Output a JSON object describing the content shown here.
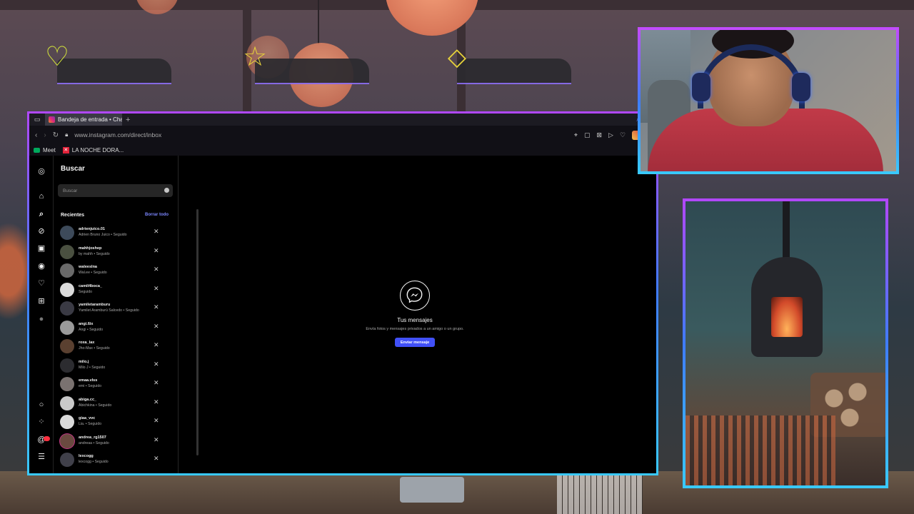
{
  "browser": {
    "tab_title": "Bandeja de entrada • Chat",
    "new_tab": "+",
    "url": "www.instagram.com/direct/inbox",
    "bookmarks": [
      {
        "label": "Meet"
      },
      {
        "label": "LA NOCHE DORA..."
      }
    ]
  },
  "instagram": {
    "panel_title": "Buscar",
    "search_placeholder": "Buscar",
    "recents_label": "Recientes",
    "clear_all_label": "Borrar todo",
    "recents": [
      {
        "username": "adrienjuico.01",
        "info": "Adrien Bruno Juico • Seguido"
      },
      {
        "username": "mahhjoshep",
        "info": "by mahh • Seguido"
      },
      {
        "username": "waleeslna",
        "info": "Wal.ee • Seguido"
      },
      {
        "username": "camil4boca_",
        "info": "Seguido"
      },
      {
        "username": "yamiletaramburu",
        "info": "Yamilet Aramburú Salcedo • Seguido"
      },
      {
        "username": "angi.6ix",
        "info": "Angi • Seguido"
      },
      {
        "username": "roxa_lax",
        "info": "Jho-Max • Seguido"
      },
      {
        "username": "milo.j",
        "info": "Milo J • Seguido"
      },
      {
        "username": "emaa.vlss",
        "info": "emi • Seguido"
      },
      {
        "username": "abiga.cc_",
        "info": "Abichkina • Seguido"
      },
      {
        "username": "giaa_vvc",
        "info": "Lia. • Seguido"
      },
      {
        "username": "andrea_rg1507",
        "info": "andreaa • Seguido"
      },
      {
        "username": "lexcogg",
        "info": "lexcogg • Seguido"
      }
    ],
    "inbox": {
      "title": "Tus mensajes",
      "subtitle": "Envía fotos y mensajes privados a un amigo o un grupo.",
      "button": "Enviar mensaje"
    }
  },
  "colors": {
    "accent": "#4150f7",
    "frame_top": "#b148ff",
    "frame_bottom": "#39c9ff"
  }
}
